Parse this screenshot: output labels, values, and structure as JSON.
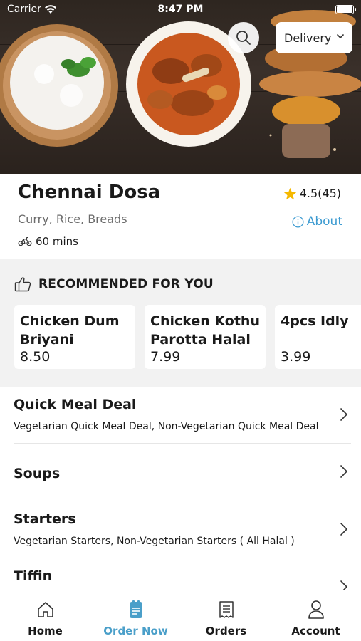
{
  "status_bar": {
    "carrier": "Carrier",
    "time": "8:47 PM"
  },
  "header": {
    "delivery_label": "Delivery",
    "search_icon": "search-icon"
  },
  "restaurant": {
    "name": "Chennai Dosa",
    "cuisine": "Curry, Rice, Breads",
    "delivery_time": "60 mins",
    "rating": "4.5(45)",
    "about_label": "About"
  },
  "recommended": {
    "heading": "RECOMMENDED FOR YOU",
    "items": [
      {
        "name": "Chicken Dum Briyani",
        "price": "8.50"
      },
      {
        "name": "Chicken Kothu Parotta Halal",
        "price": "7.99"
      },
      {
        "name": "4pcs Idly",
        "price": "3.99"
      }
    ]
  },
  "categories": [
    {
      "title": "Quick Meal Deal",
      "subtitle": "Vegetarian Quick Meal Deal, Non-Vegetarian Quick Meal Deal"
    },
    {
      "title": "Soups",
      "subtitle": ""
    },
    {
      "title": "Starters",
      "subtitle": "Vegetarian Starters, Non-Vegetarian Starters ( All Halal )"
    },
    {
      "title": "Tiffin",
      "subtitle": ""
    }
  ],
  "tabbar": {
    "tabs": [
      {
        "label": "Home",
        "icon": "home-icon"
      },
      {
        "label": "Order Now",
        "icon": "order-now-icon",
        "active": true
      },
      {
        "label": "Orders",
        "icon": "orders-icon"
      },
      {
        "label": "Account",
        "icon": "account-icon"
      }
    ]
  },
  "colors": {
    "accent": "#4a9fc9",
    "about_link": "#3d9bd1",
    "star": "#f5b800",
    "section_bg": "#f2f2f2"
  }
}
